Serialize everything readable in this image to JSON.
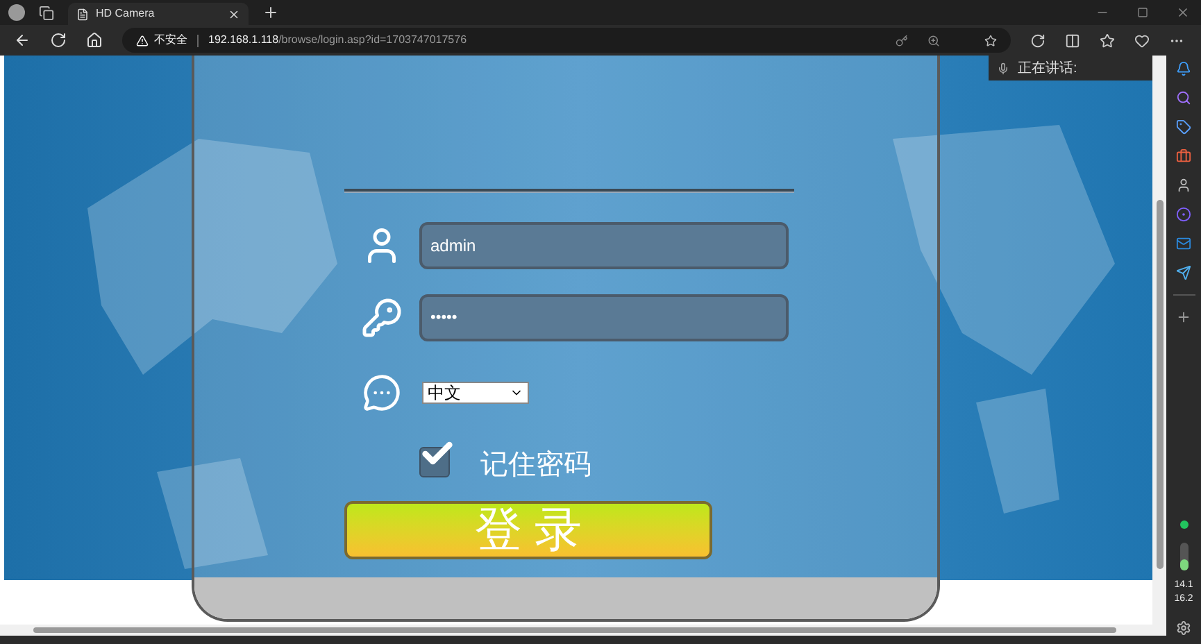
{
  "browser": {
    "tabs": [
      {
        "title": "HD Camera",
        "selected": true
      }
    ],
    "address": {
      "security": "不安全",
      "host": "192.168.1.118",
      "path": "/browse/login.asp?id=1703747017576"
    },
    "voice_popup": {
      "label": "正在讲话:"
    },
    "sidebar_stats": [
      "14.1",
      "16.2"
    ]
  },
  "login": {
    "username": {
      "value": "admin"
    },
    "password": {
      "value": "•••••"
    },
    "language": {
      "value": "中文"
    },
    "remember": {
      "label": "记住密码",
      "checked": true
    },
    "submit": {
      "label": "登 录"
    }
  }
}
